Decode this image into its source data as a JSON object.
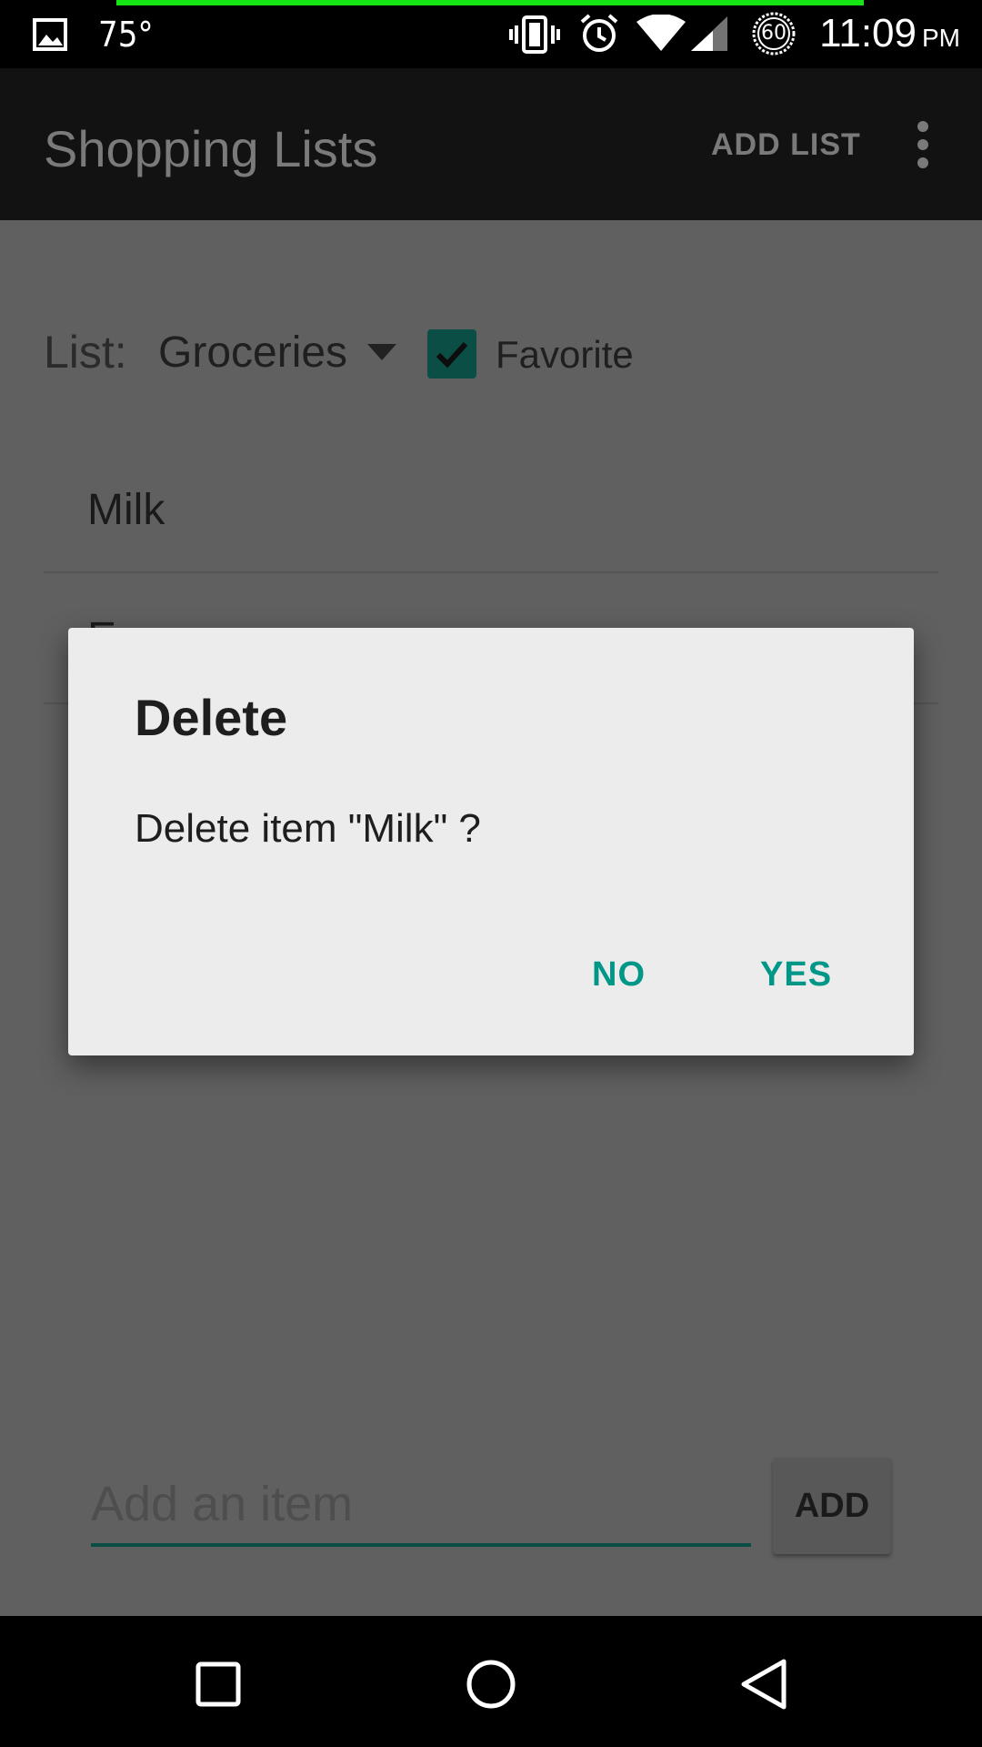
{
  "status_bar": {
    "temperature": "75°",
    "battery_level": "60",
    "time": "11:09",
    "ampm": "PM",
    "icons": [
      "image-icon",
      "vibrate-icon",
      "alarm-icon",
      "wifi-icon",
      "signal-icon",
      "battery-icon"
    ]
  },
  "app_bar": {
    "title": "Shopping Lists",
    "add_list_label": "ADD LIST",
    "overflow_icon": "more-vert-icon"
  },
  "list_selector": {
    "label": "List:",
    "selected": "Groceries",
    "favorite_label": "Favorite",
    "favorite_checked": true
  },
  "items": [
    {
      "name": "Milk"
    },
    {
      "name": "E"
    }
  ],
  "add_item": {
    "placeholder": "Add an item",
    "button_label": "ADD"
  },
  "dialog": {
    "title": "Delete",
    "message": "Delete item \"Milk\" ?",
    "no_label": "NO",
    "yes_label": "YES"
  },
  "nav_bar": {
    "icons": [
      "recent-apps-icon",
      "home-icon",
      "back-icon"
    ]
  },
  "colors": {
    "accent": "#009688",
    "checkbox": "#0a4e46",
    "progress": "#15e515"
  }
}
